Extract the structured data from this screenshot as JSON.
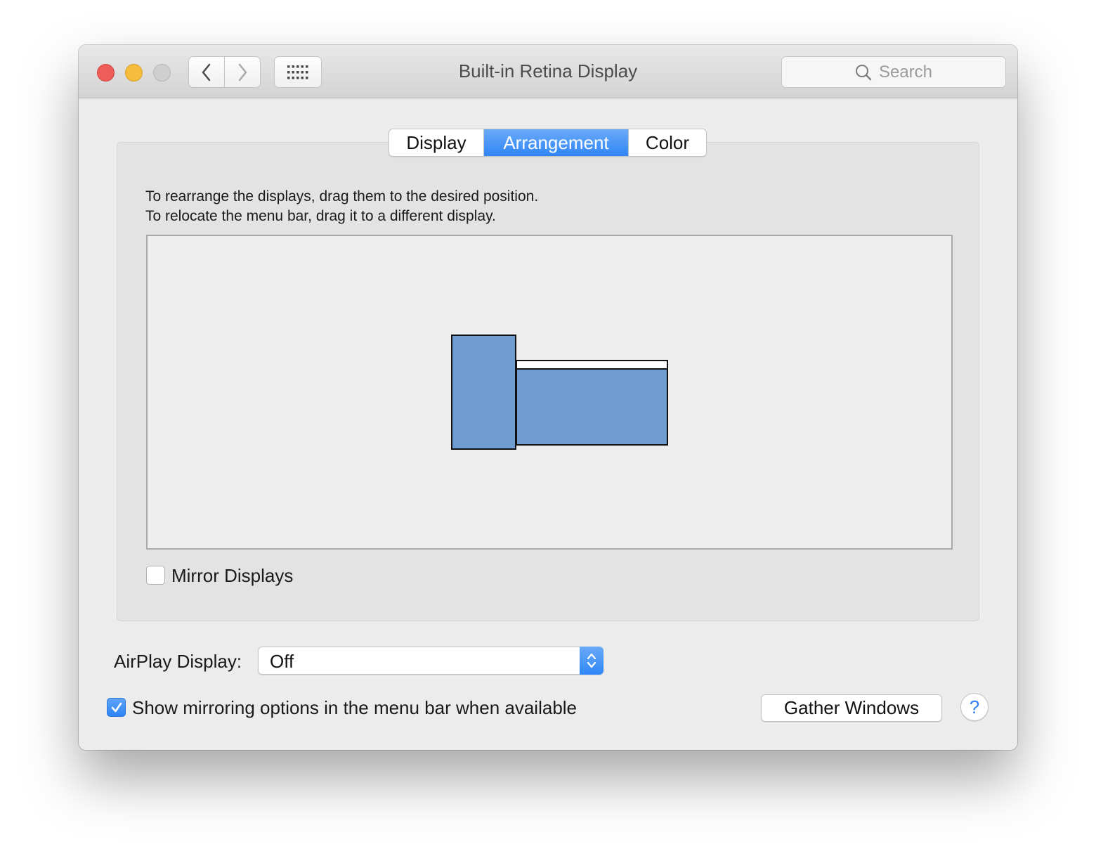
{
  "window": {
    "title": "Built-in Retina Display",
    "search_placeholder": "Search"
  },
  "icons": {
    "back": "chevron-left-icon",
    "forward": "chevron-right-icon",
    "grid": "grid-icon",
    "search": "search-icon",
    "checkmark": "checkmark-icon",
    "popup_arrows": "chevron-up-down-icon"
  },
  "tabs": [
    {
      "label": "Display",
      "selected": false
    },
    {
      "label": "Arrangement",
      "selected": true
    },
    {
      "label": "Color",
      "selected": false
    }
  ],
  "arrangement": {
    "instruction_line1": "To rearrange the displays, drag them to the desired position.",
    "instruction_line2": "To relocate the menu bar, drag it to a different display.",
    "display_color": "#6f9dd2"
  },
  "mirror_displays": {
    "label": "Mirror Displays",
    "checked": false
  },
  "airplay": {
    "label": "AirPlay Display:",
    "value": "Off"
  },
  "show_mirroring": {
    "label": "Show mirroring options in the menu bar when available",
    "checked": true
  },
  "gather_windows_label": "Gather Windows",
  "help_label": "?",
  "colors": {
    "accent": "#2f86f6",
    "close": "#ee5d57",
    "minimize": "#f5bd3b",
    "zoom_disabled": "#cfcfcf"
  }
}
